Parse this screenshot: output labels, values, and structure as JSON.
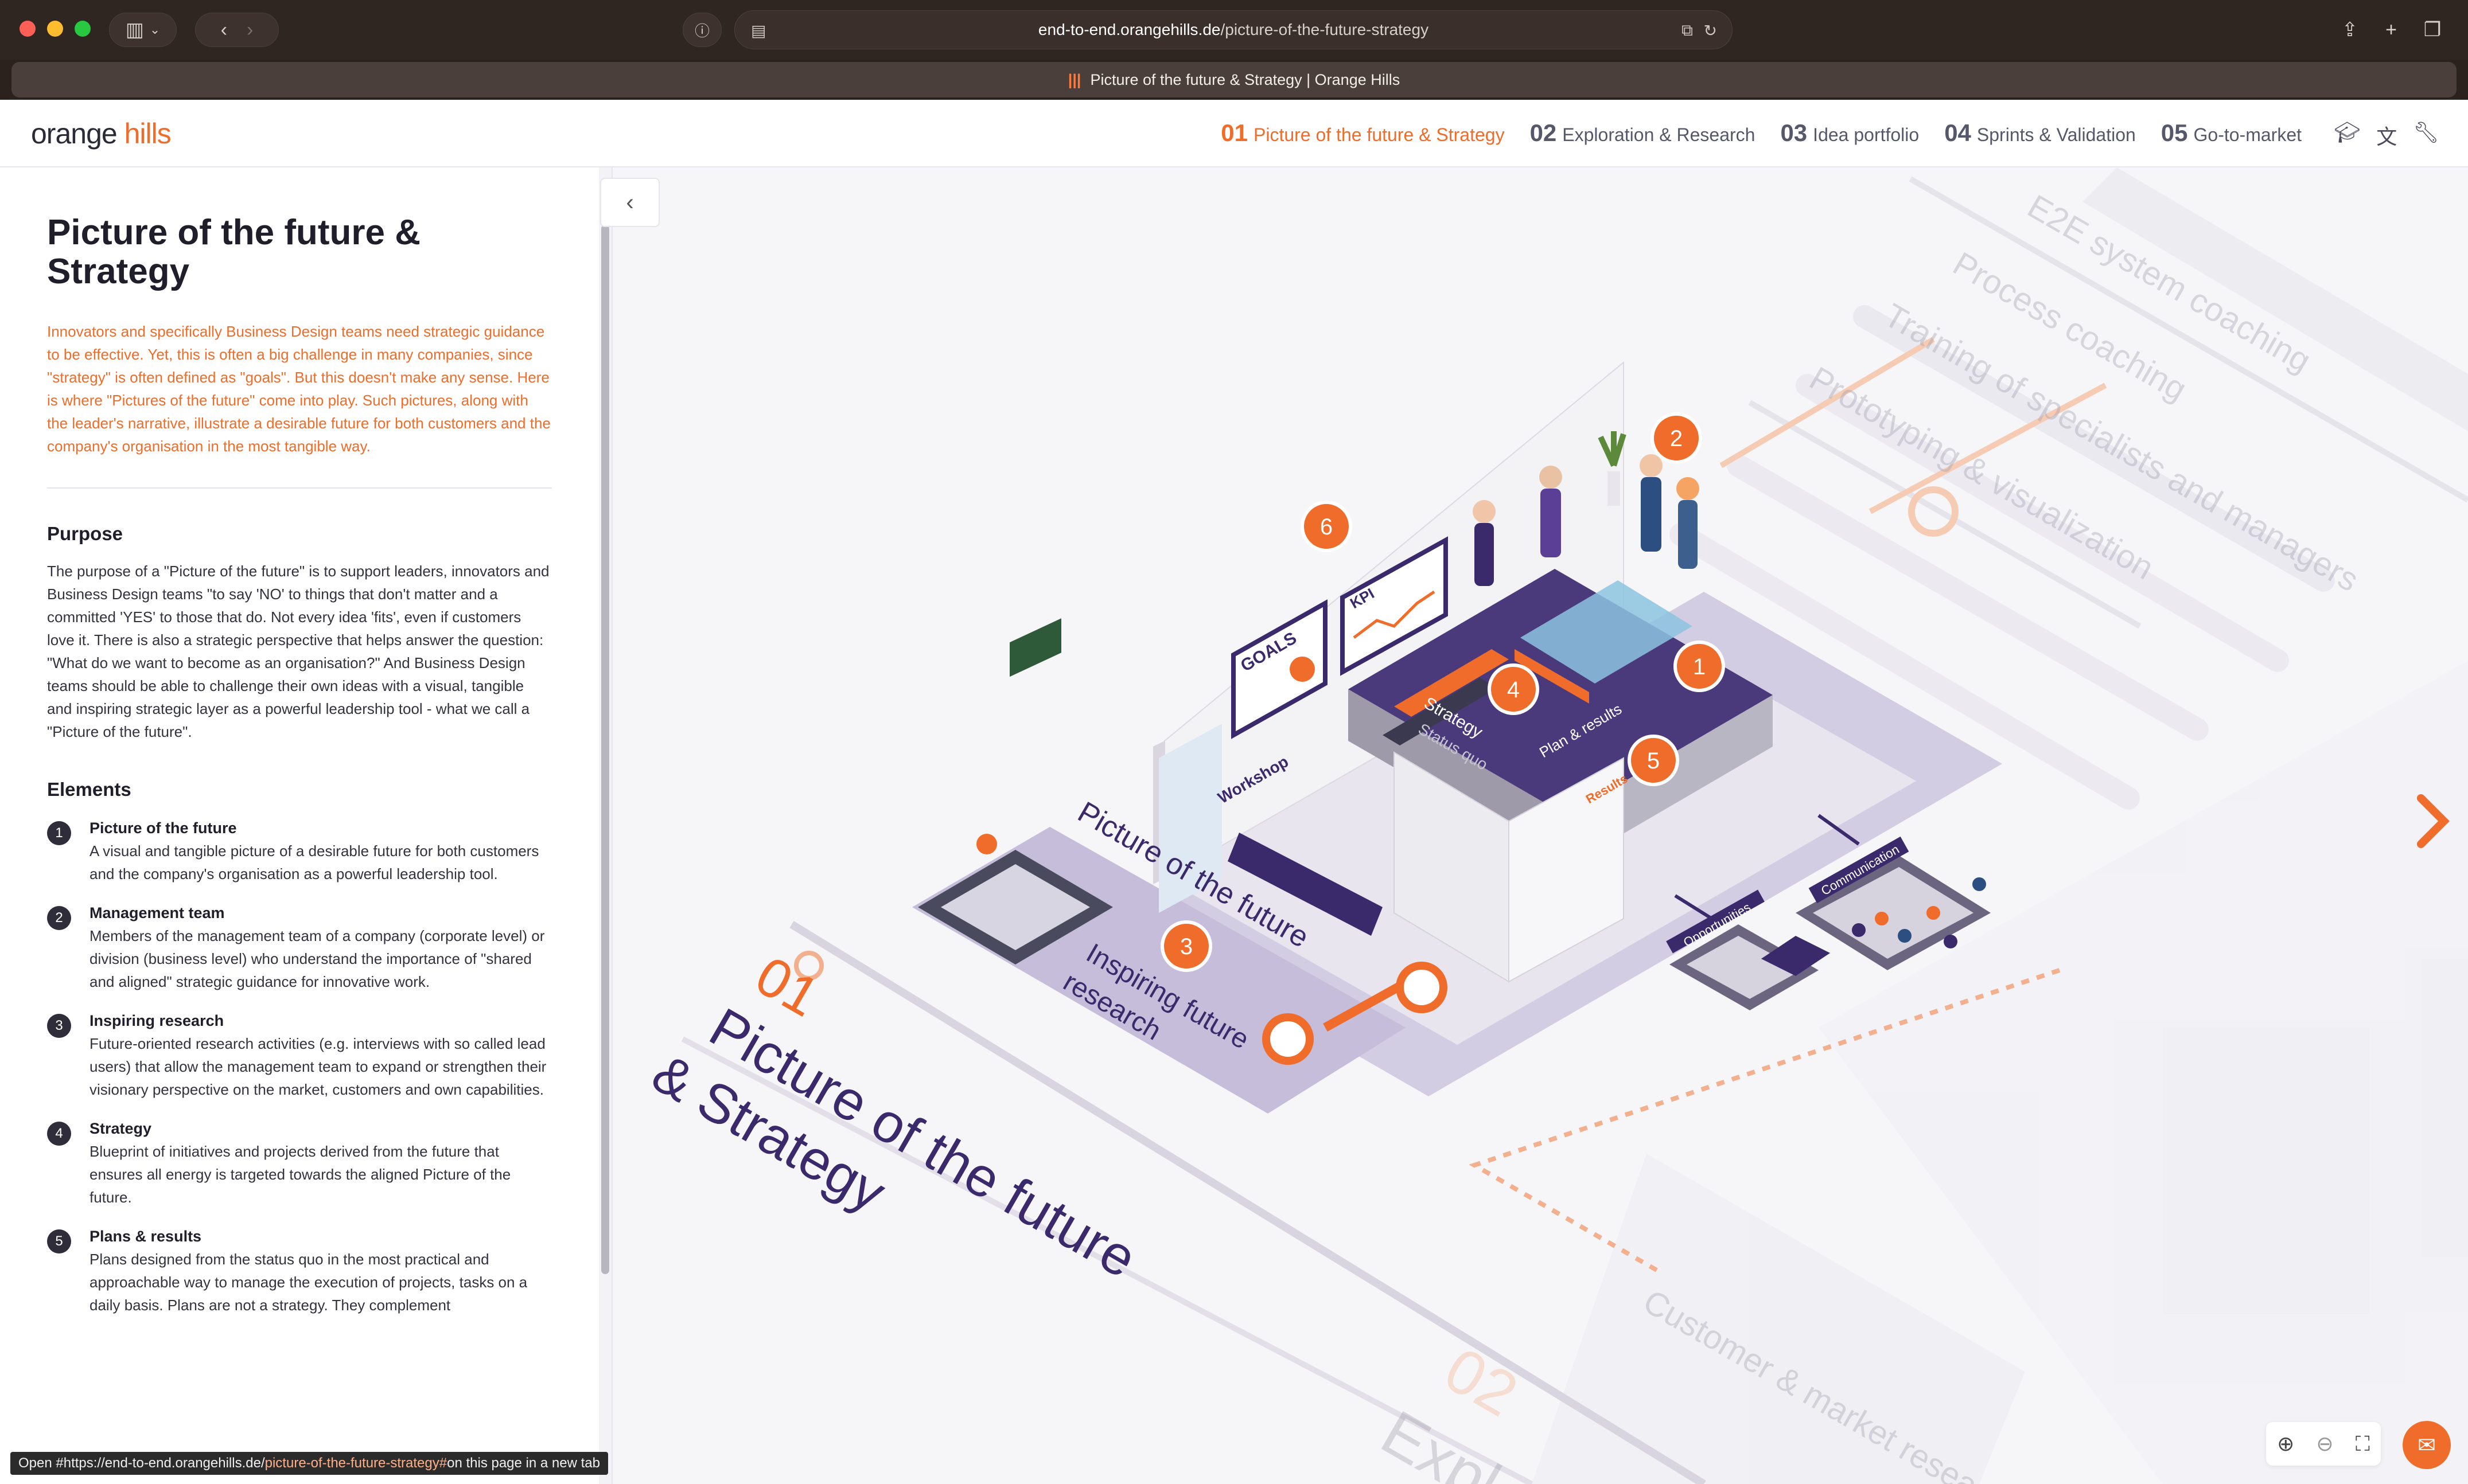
{
  "browser": {
    "url_host": "end-to-end.orangehills.de",
    "url_path": "/picture-of-the-future-strategy",
    "tab_title": "Picture of the future & Strategy | Orange Hills",
    "status_prefix": "Open #https://end-to-end.orangehills.de/",
    "status_highlight": "picture-of-the-future-strategy#",
    "status_suffix": " on this page in a new tab"
  },
  "header": {
    "logo_main": "orange ",
    "logo_accent": "hills",
    "nav": [
      {
        "num": "01",
        "label": "Picture of the future & Strategy"
      },
      {
        "num": "02",
        "label": "Exploration & Research"
      },
      {
        "num": "03",
        "label": "Idea portfolio"
      },
      {
        "num": "04",
        "label": "Sprints & Validation"
      },
      {
        "num": "05",
        "label": "Go-to-market"
      }
    ]
  },
  "sidebar": {
    "title": "Picture of the future & Strategy",
    "intro": "Innovators and specifically Business Design teams need strategic guidance to be effective. Yet, this is often a big challenge in many companies, since \"strategy\" is often defined as \"goals\". But this doesn't make any sense. Here is where \"Pictures of the future\" come into play. Such pictures, along with the leader's narrative, illustrate a desirable future for both customers and the company's organisation in the most tangible way.",
    "purpose_heading": "Purpose",
    "purpose_text": "The purpose of a \"Picture of the future\" is to support leaders, innovators and Business Design teams \"to say 'NO' to things that don't matter and a committed 'YES' to those that do. Not every idea 'fits', even if customers love it. There is also a strategic perspective that helps answer the question: \"What do we want to become as an organisation?\" And Business Design teams should be able to challenge their own ideas with a visual, tangible and inspiring strategic layer as a powerful leadership tool - what we call a \"Picture of the future\".",
    "elements_heading": "Elements",
    "elements": [
      {
        "num": "1",
        "title": "Picture of the future",
        "text": "A visual and tangible picture of a desirable future for both customers and the company's organisation as a powerful leadership tool."
      },
      {
        "num": "2",
        "title": "Management team",
        "text": "Members of the management team of a company (corporate level) or division (business level) who understand the importance of \"shared and aligned\" strategic guidance for innovative work."
      },
      {
        "num": "3",
        "title": "Inspiring research",
        "text": "Future-oriented research activities (e.g. interviews with so called lead users) that allow the management team to expand or strengthen their visionary perspective on the market, customers and own capabilities."
      },
      {
        "num": "4",
        "title": "Strategy",
        "text": "Blueprint of initiatives and projects derived from the future that ensures all energy is targeted towards the aligned Picture of the future."
      },
      {
        "num": "5",
        "title": "Plans & results",
        "text": "Plans designed from the status quo in the most practical and approachable way to manage the execution of projects, tasks on a daily basis. Plans are not a strategy. They complement"
      }
    ]
  },
  "canvas": {
    "stage_num": "01",
    "stage_title_1": "Picture of the future",
    "stage_title_2": "& Strategy",
    "label_pof": "Picture of the future",
    "label_research_1": "Inspiring future",
    "label_research_2": "research",
    "label_strategy": "Strategy",
    "label_status_quo": "Status quo",
    "label_plan": "Plan & results",
    "label_goals": "GOALS",
    "label_kpi": "KPI",
    "label_workshop": "Workshop",
    "label_opportunities": "Opportunities",
    "label_communication": "Communication",
    "label_results": "Results",
    "coach_labels": [
      "E2E system coaching",
      "Process coaching",
      "Training of specialists and managers",
      "Prototyping & visualization"
    ],
    "stage2_num": "02",
    "stage2_title": "Expl",
    "label_customer_research": "Customer & market research",
    "markers": [
      "1",
      "2",
      "3",
      "4",
      "5",
      "6"
    ],
    "colors": {
      "accent": "#ef6c2a",
      "purple": "#3b2a6b",
      "lavender": "#c9c2dc"
    }
  }
}
